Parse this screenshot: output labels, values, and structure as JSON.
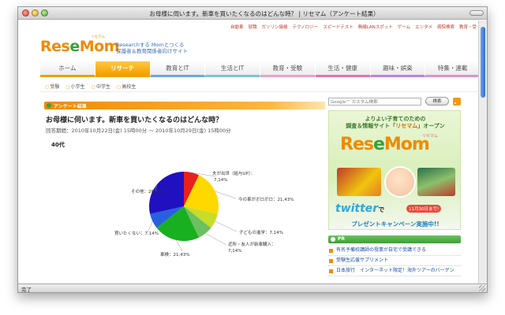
{
  "window": {
    "title": "お母様に伺います。新車を買いたくなるのはどんな時？ | リセマム（アンケート結果）"
  },
  "utility_nav": [
    "自動車",
    "就職",
    "ガソリン価格",
    "テクノロジー",
    "スピードテスト",
    "無線LANスポット",
    "ゲーム",
    "エンタメ",
    "病院検索",
    "教育・受"
  ],
  "site": {
    "logo_prefix": "Res",
    "logo_o": "e",
    "logo_suffix": "Mom",
    "logo_ruby": "リセマム",
    "tagline_line1": "Researchする Momとつくる",
    "tagline_line2": "保護者＆教育関係者向けサイト"
  },
  "main_nav": [
    "ホーム",
    "リサーチ",
    "教育とIT",
    "生活とIT",
    "教育・受験",
    "生活・健康",
    "趣味・娯楽",
    "特集・連載"
  ],
  "sub_nav": [
    "受験",
    "小学生",
    "中学生",
    "高校生"
  ],
  "article": {
    "section_label": "アンケート結果",
    "question": "お母様に伺います。新車を買いたくなるのはどんな時？",
    "period": "回答期間：2010年10月22日(金) 15時00分 〜 2010年10月29日(金) 15時00分",
    "age_group": "40代"
  },
  "chart_data": {
    "type": "pie",
    "title": "40代",
    "slices": [
      {
        "label": "夫が出世（給与UP）",
        "value": 7.14,
        "value_text": "7,14%",
        "color": "#e8201e"
      },
      {
        "label": "今の車がボロボロ",
        "value": 21.43,
        "value_text": "21,43%",
        "color": "#ffd800"
      },
      {
        "label": "子どもの進学",
        "value": 7.14,
        "value_text": "7,14%",
        "color": "#c8dc28"
      },
      {
        "label": "近所・友人が新車購入",
        "value": 7.14,
        "value_text": "7,14%",
        "color": "#6cc060"
      },
      {
        "label": "車検",
        "value": 21.43,
        "value_text": "21,43%",
        "color": "#18b020"
      },
      {
        "label": "買いたくない",
        "value": 7.14,
        "value_text": "7,14%",
        "color": "#2860e0"
      },
      {
        "label": "その他",
        "value": 28.57,
        "value_text": "28,57%",
        "color": "#2010c0"
      }
    ],
    "label_texts": [
      "夫が出世（給与UP）：",
      "7,14%",
      "今の車がボロボロ：21,43%",
      "子どもの進学：7,14%",
      "近所・友人が新車購入：",
      "7,14%",
      "車検：21,43%",
      "買いたくない：7,14%",
      "その他：28,57%"
    ]
  },
  "sidebar": {
    "search_placeholder": "Google™ カスタム検索",
    "search_button": "検索",
    "banner": {
      "line1": "よりよい子育てのための",
      "line2_a": "調査＆情報サイト「",
      "line2_b": "リセマム",
      "line2_c": "」オープン",
      "logo_prefix": "Res",
      "logo_o": "e",
      "logo_suffix": "Mom",
      "ruby": "リセマム",
      "twitter": "twitter",
      "twitter_suffix": "で",
      "date_badge": "11月30日まで!",
      "campaign": "プレゼントキャンペーン実施中!!"
    },
    "pr_label": "PR",
    "pr_items": [
      "有名予備校講師の授業が自宅で受講できる",
      "受験生応援サプリメント",
      "日本旅行　インターネット限定！海外ツアーのバーゲン"
    ]
  },
  "status": {
    "text": "完了"
  },
  "colors": {
    "brand_orange": "#f08a00",
    "brand_green": "#3aa040"
  }
}
